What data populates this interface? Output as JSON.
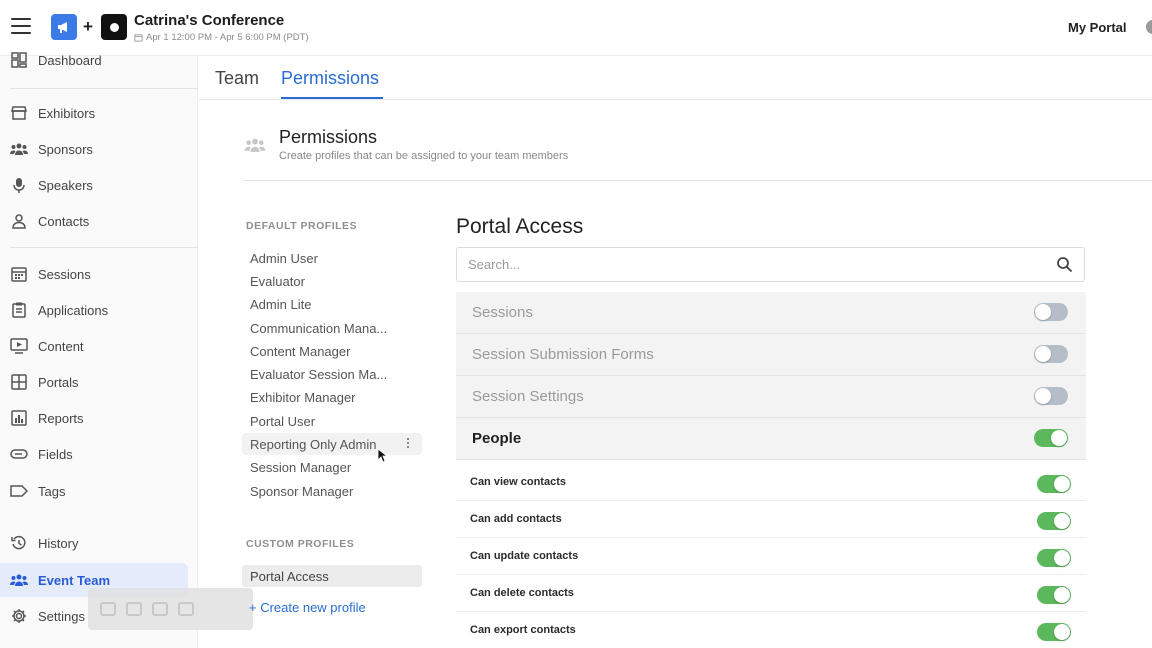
{
  "header": {
    "conference_title": "Catrina's Conference",
    "conference_dates": "Apr 1 12:00 PM - Apr 5 6:00 PM (PDT)",
    "plus": "+",
    "my_portal": "My Portal"
  },
  "sidebar": {
    "items": [
      {
        "label": "Dashboard",
        "icon": "dashboard-icon"
      },
      {
        "label": "Exhibitors",
        "icon": "storefront-icon"
      },
      {
        "label": "Sponsors",
        "icon": "people-group-icon"
      },
      {
        "label": "Speakers",
        "icon": "microphone-icon"
      },
      {
        "label": "Contacts",
        "icon": "person-icon"
      },
      {
        "label": "Sessions",
        "icon": "calendar-icon"
      },
      {
        "label": "Applications",
        "icon": "clipboard-icon"
      },
      {
        "label": "Content",
        "icon": "play-screen-icon"
      },
      {
        "label": "Portals",
        "icon": "grid-icon"
      },
      {
        "label": "Reports",
        "icon": "bar-chart-icon"
      },
      {
        "label": "Fields",
        "icon": "input-field-icon"
      },
      {
        "label": "Tags",
        "icon": "tag-icon"
      },
      {
        "label": "History",
        "icon": "history-icon"
      },
      {
        "label": "Event Team",
        "icon": "team-icon",
        "active": true
      },
      {
        "label": "Settings",
        "icon": "gear-icon"
      }
    ]
  },
  "tabs": [
    {
      "label": "Team",
      "active": false
    },
    {
      "label": "Permissions",
      "active": true
    }
  ],
  "permissions": {
    "title": "Permissions",
    "subtitle": "Create profiles that can be assigned to your team members"
  },
  "default_profiles": {
    "label": "DEFAULT PROFILES",
    "items": [
      "Admin User",
      "Evaluator",
      "Admin Lite",
      "Communication Mana...",
      "Content Manager",
      "Evaluator Session Ma...",
      "Exhibitor Manager",
      "Portal User",
      "Reporting Only Admin",
      "Session Manager",
      "Sponsor Manager"
    ],
    "hovered": "Reporting Only Admin"
  },
  "custom_profiles": {
    "label": "CUSTOM PROFILES",
    "items": [
      "Portal Access"
    ],
    "selected": "Portal Access",
    "create_link": "+ Create new profile"
  },
  "portal_access": {
    "title": "Portal Access",
    "search_placeholder": "Search...",
    "rows": [
      {
        "label": "Sessions",
        "enabled": false
      },
      {
        "label": "Session Submission Forms",
        "enabled": false
      },
      {
        "label": "Session Settings",
        "enabled": false
      },
      {
        "label": "People",
        "enabled": true
      }
    ],
    "people_permissions": [
      {
        "label": "Can view contacts",
        "enabled": true
      },
      {
        "label": "Can add contacts",
        "enabled": true
      },
      {
        "label": "Can update contacts",
        "enabled": true
      },
      {
        "label": "Can delete contacts",
        "enabled": true
      },
      {
        "label": "Can export contacts",
        "enabled": true
      }
    ]
  },
  "colors": {
    "accent": "#2a6dd2",
    "toggle_on": "#5cb85c",
    "toggle_off": "#b5bec8",
    "logo_blue": "#3b7be8"
  }
}
